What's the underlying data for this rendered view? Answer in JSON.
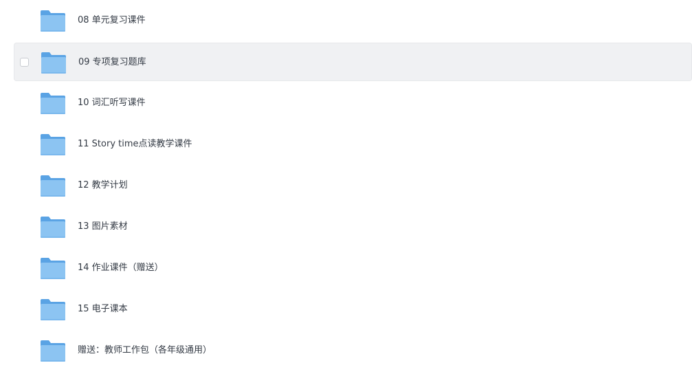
{
  "files": [
    {
      "name": "08 单元复习课件",
      "icon": "folder-icon",
      "hovered": false
    },
    {
      "name": "09 专项复习题库",
      "icon": "folder-icon",
      "hovered": true
    },
    {
      "name": "10 词汇听写课件",
      "icon": "folder-icon",
      "hovered": false
    },
    {
      "name": "11 Story time点读教学课件",
      "icon": "folder-icon",
      "hovered": false
    },
    {
      "name": "12 教学计划",
      "icon": "folder-icon",
      "hovered": false
    },
    {
      "name": "13 图片素材",
      "icon": "folder-icon",
      "hovered": false
    },
    {
      "name": "14 作业课件（赠送）",
      "icon": "folder-icon",
      "hovered": false
    },
    {
      "name": "15 电子课本",
      "icon": "folder-icon",
      "hovered": false
    },
    {
      "name": "赠送：教师工作包（各年级通用）",
      "icon": "folder-icon",
      "hovered": false
    }
  ],
  "colors": {
    "folder_back": "#5aa3e4",
    "folder_front": "#8cc4f2",
    "hover_bg": "#f0f1f3",
    "text": "#333a44"
  }
}
